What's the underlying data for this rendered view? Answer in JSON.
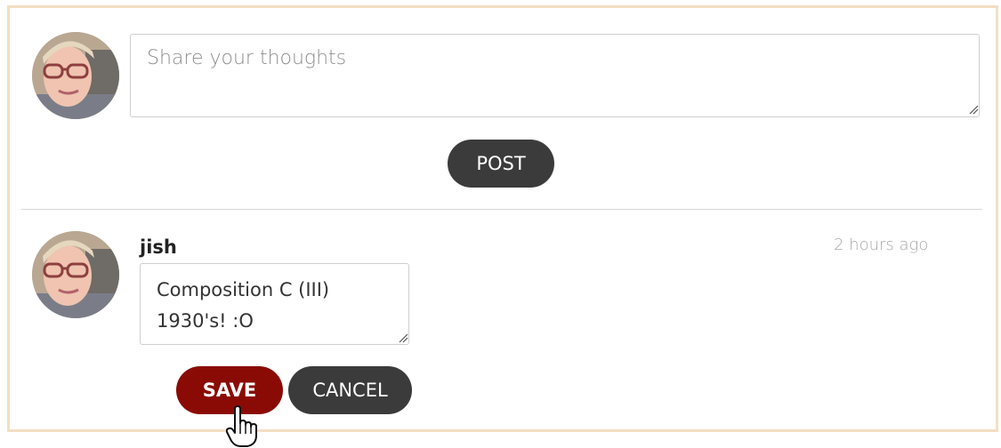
{
  "composer": {
    "placeholder": "Share your thoughts",
    "post_label": "POST"
  },
  "comment": {
    "author": "jish",
    "time": "2 hours ago",
    "edit_text": "Composition C (III)\n1930's! :O",
    "save_label": "SAVE",
    "cancel_label": "CANCEL"
  },
  "colors": {
    "border_accent": "#f3dfc2",
    "dark_button": "#3b3b3b",
    "save_button": "#8a0b05"
  },
  "icons": {
    "avatar": "user-avatar-photo",
    "cursor": "hand-pointer-icon",
    "grip": "resize-grip-icon"
  }
}
